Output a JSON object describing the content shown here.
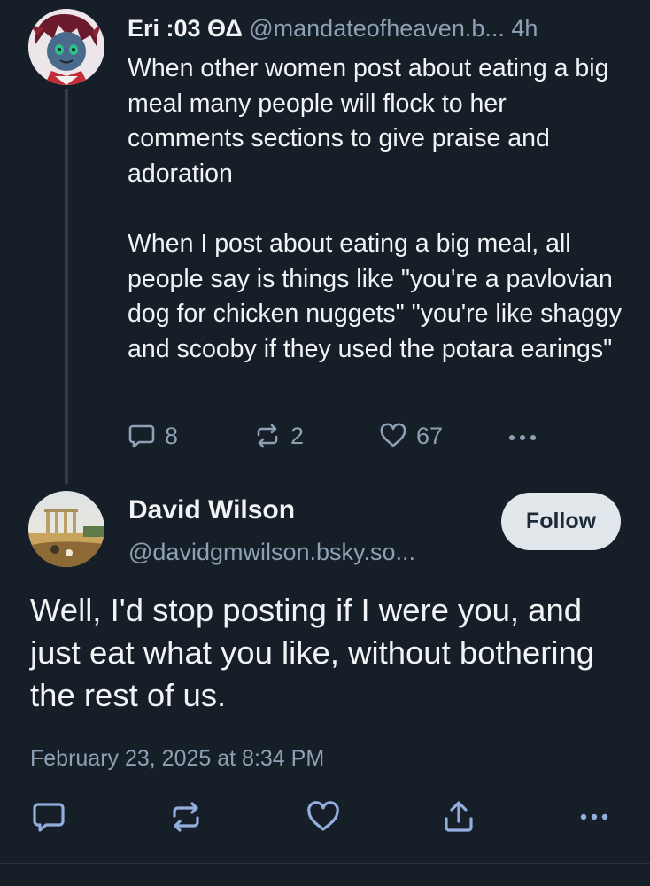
{
  "parent_post": {
    "display_name": "Eri :03 ΘΔ",
    "handle": "@mandateofheaven.b...",
    "time": "4h",
    "text": "When other women post about eating a big meal many people will flock to her comments sections to give praise and adoration\n\nWhen I post about eating a big meal, all people say is things like \"you're a pavlovian dog for chicken nuggets\" \"you're like shaggy and scooby if they used the potara earings\"",
    "reply_count": "8",
    "repost_count": "2",
    "like_count": "67",
    "icons": [
      "reply-icon",
      "repost-icon",
      "like-icon",
      "more-icon"
    ]
  },
  "reply_post": {
    "display_name": "David Wilson",
    "handle": "@davidgmwilson.bsky.so...",
    "follow_label": "Follow",
    "text": "Well, I'd stop posting if I were you, and just eat what you like, without bothering the rest of us.",
    "timestamp": "February 23, 2025 at 8:34 PM",
    "icons": [
      "reply-icon",
      "repost-icon",
      "like-icon",
      "share-icon",
      "more-icon"
    ]
  },
  "colors": {
    "background": "#161e27",
    "text": "#f1f3f5",
    "muted": "#8da0b4",
    "thread_line": "#2e3c4c",
    "follow_bg": "#e2e7ec",
    "follow_text": "#1d2a38",
    "icon_accent": "#93aede"
  }
}
